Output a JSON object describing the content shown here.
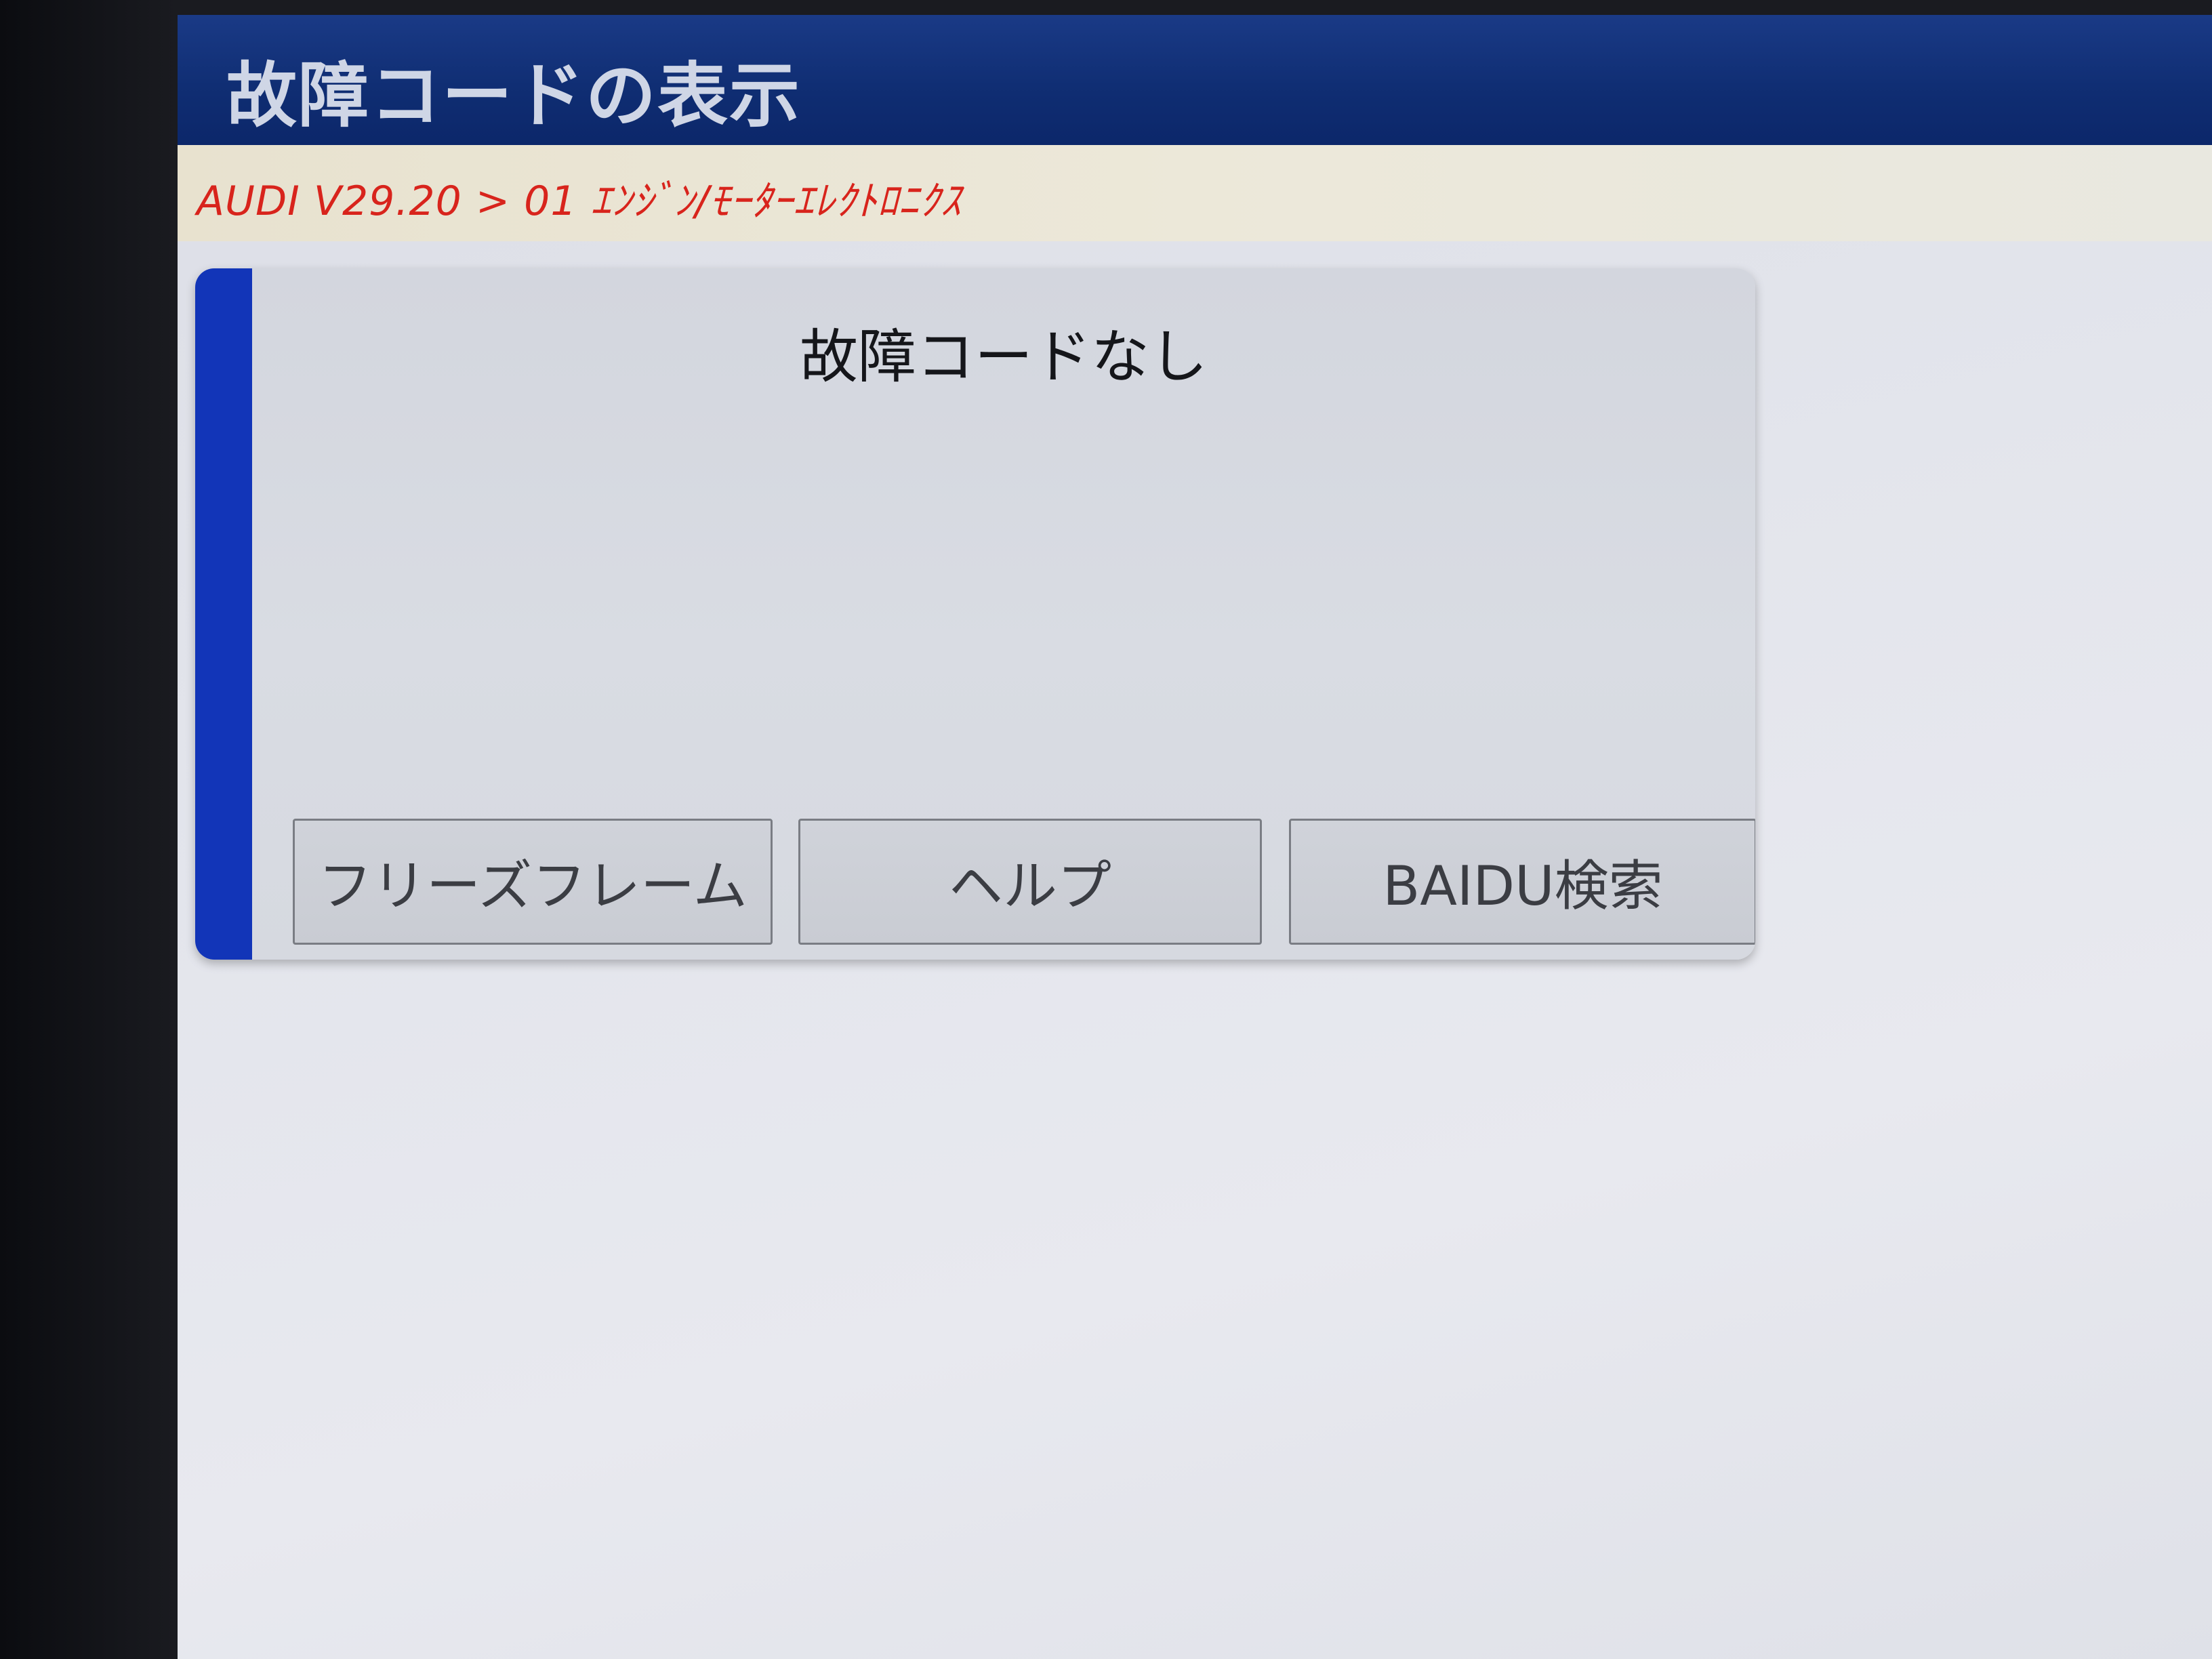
{
  "window": {
    "title": "故障コードの表示"
  },
  "breadcrumb": {
    "path": "AUDI V29.20 > 01 ｴﾝｼﾞﾝ/ﾓｰﾀｰｴﾚｸﾄﾛﾆｸｽ"
  },
  "result_panel": {
    "message": "故障コードなし",
    "buttons": {
      "freeze_frame": "フリーズフレーム",
      "help": "ヘルプ",
      "baidu_search": "BAIDU検索"
    }
  },
  "colors": {
    "title_bar": "#0f2d72",
    "breadcrumb_text": "#d8241c",
    "panel_accent": "#1235b8"
  }
}
